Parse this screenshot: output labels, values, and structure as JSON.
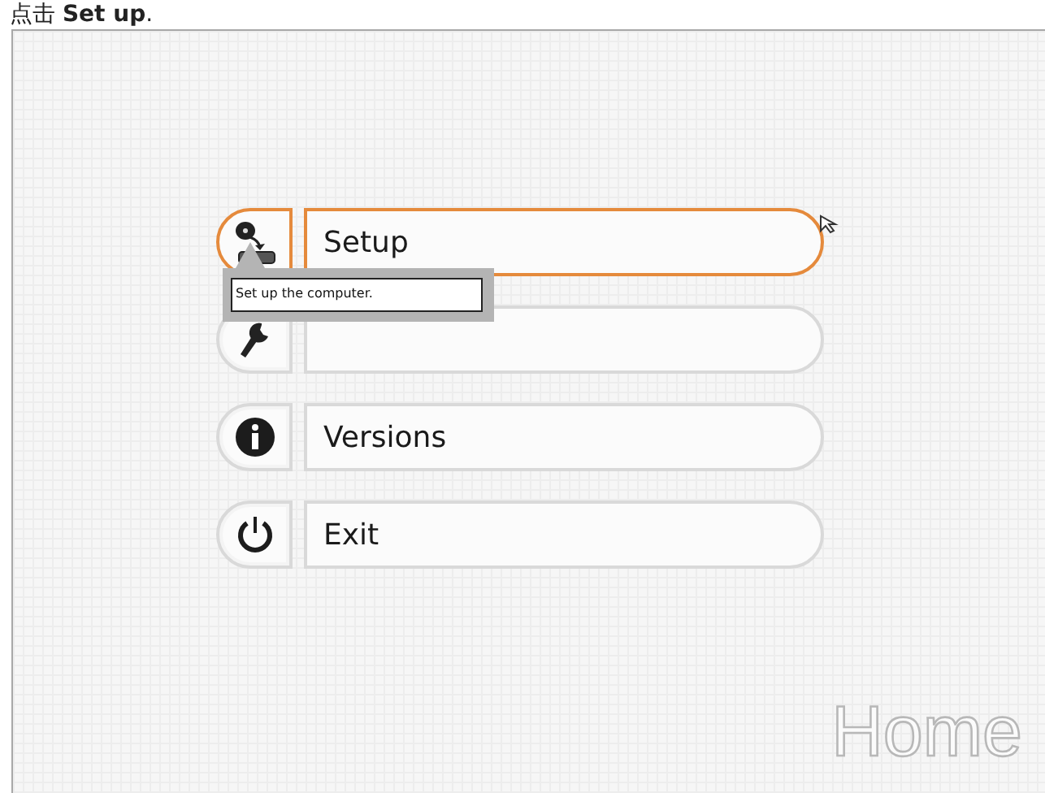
{
  "caption": "点击 **Set up**.",
  "menu": [
    {
      "kind": "setup",
      "label": "Setup",
      "selected": true
    },
    {
      "kind": "controls",
      "selected": false
    },
    {
      "kind": "info",
      "label": "Versions",
      "selected": false
    },
    {
      "kind": "power",
      "label": "Exit",
      "selected": false
    }
  ],
  "tooltip": "Set up the computer.",
  "page_title": "Home"
}
